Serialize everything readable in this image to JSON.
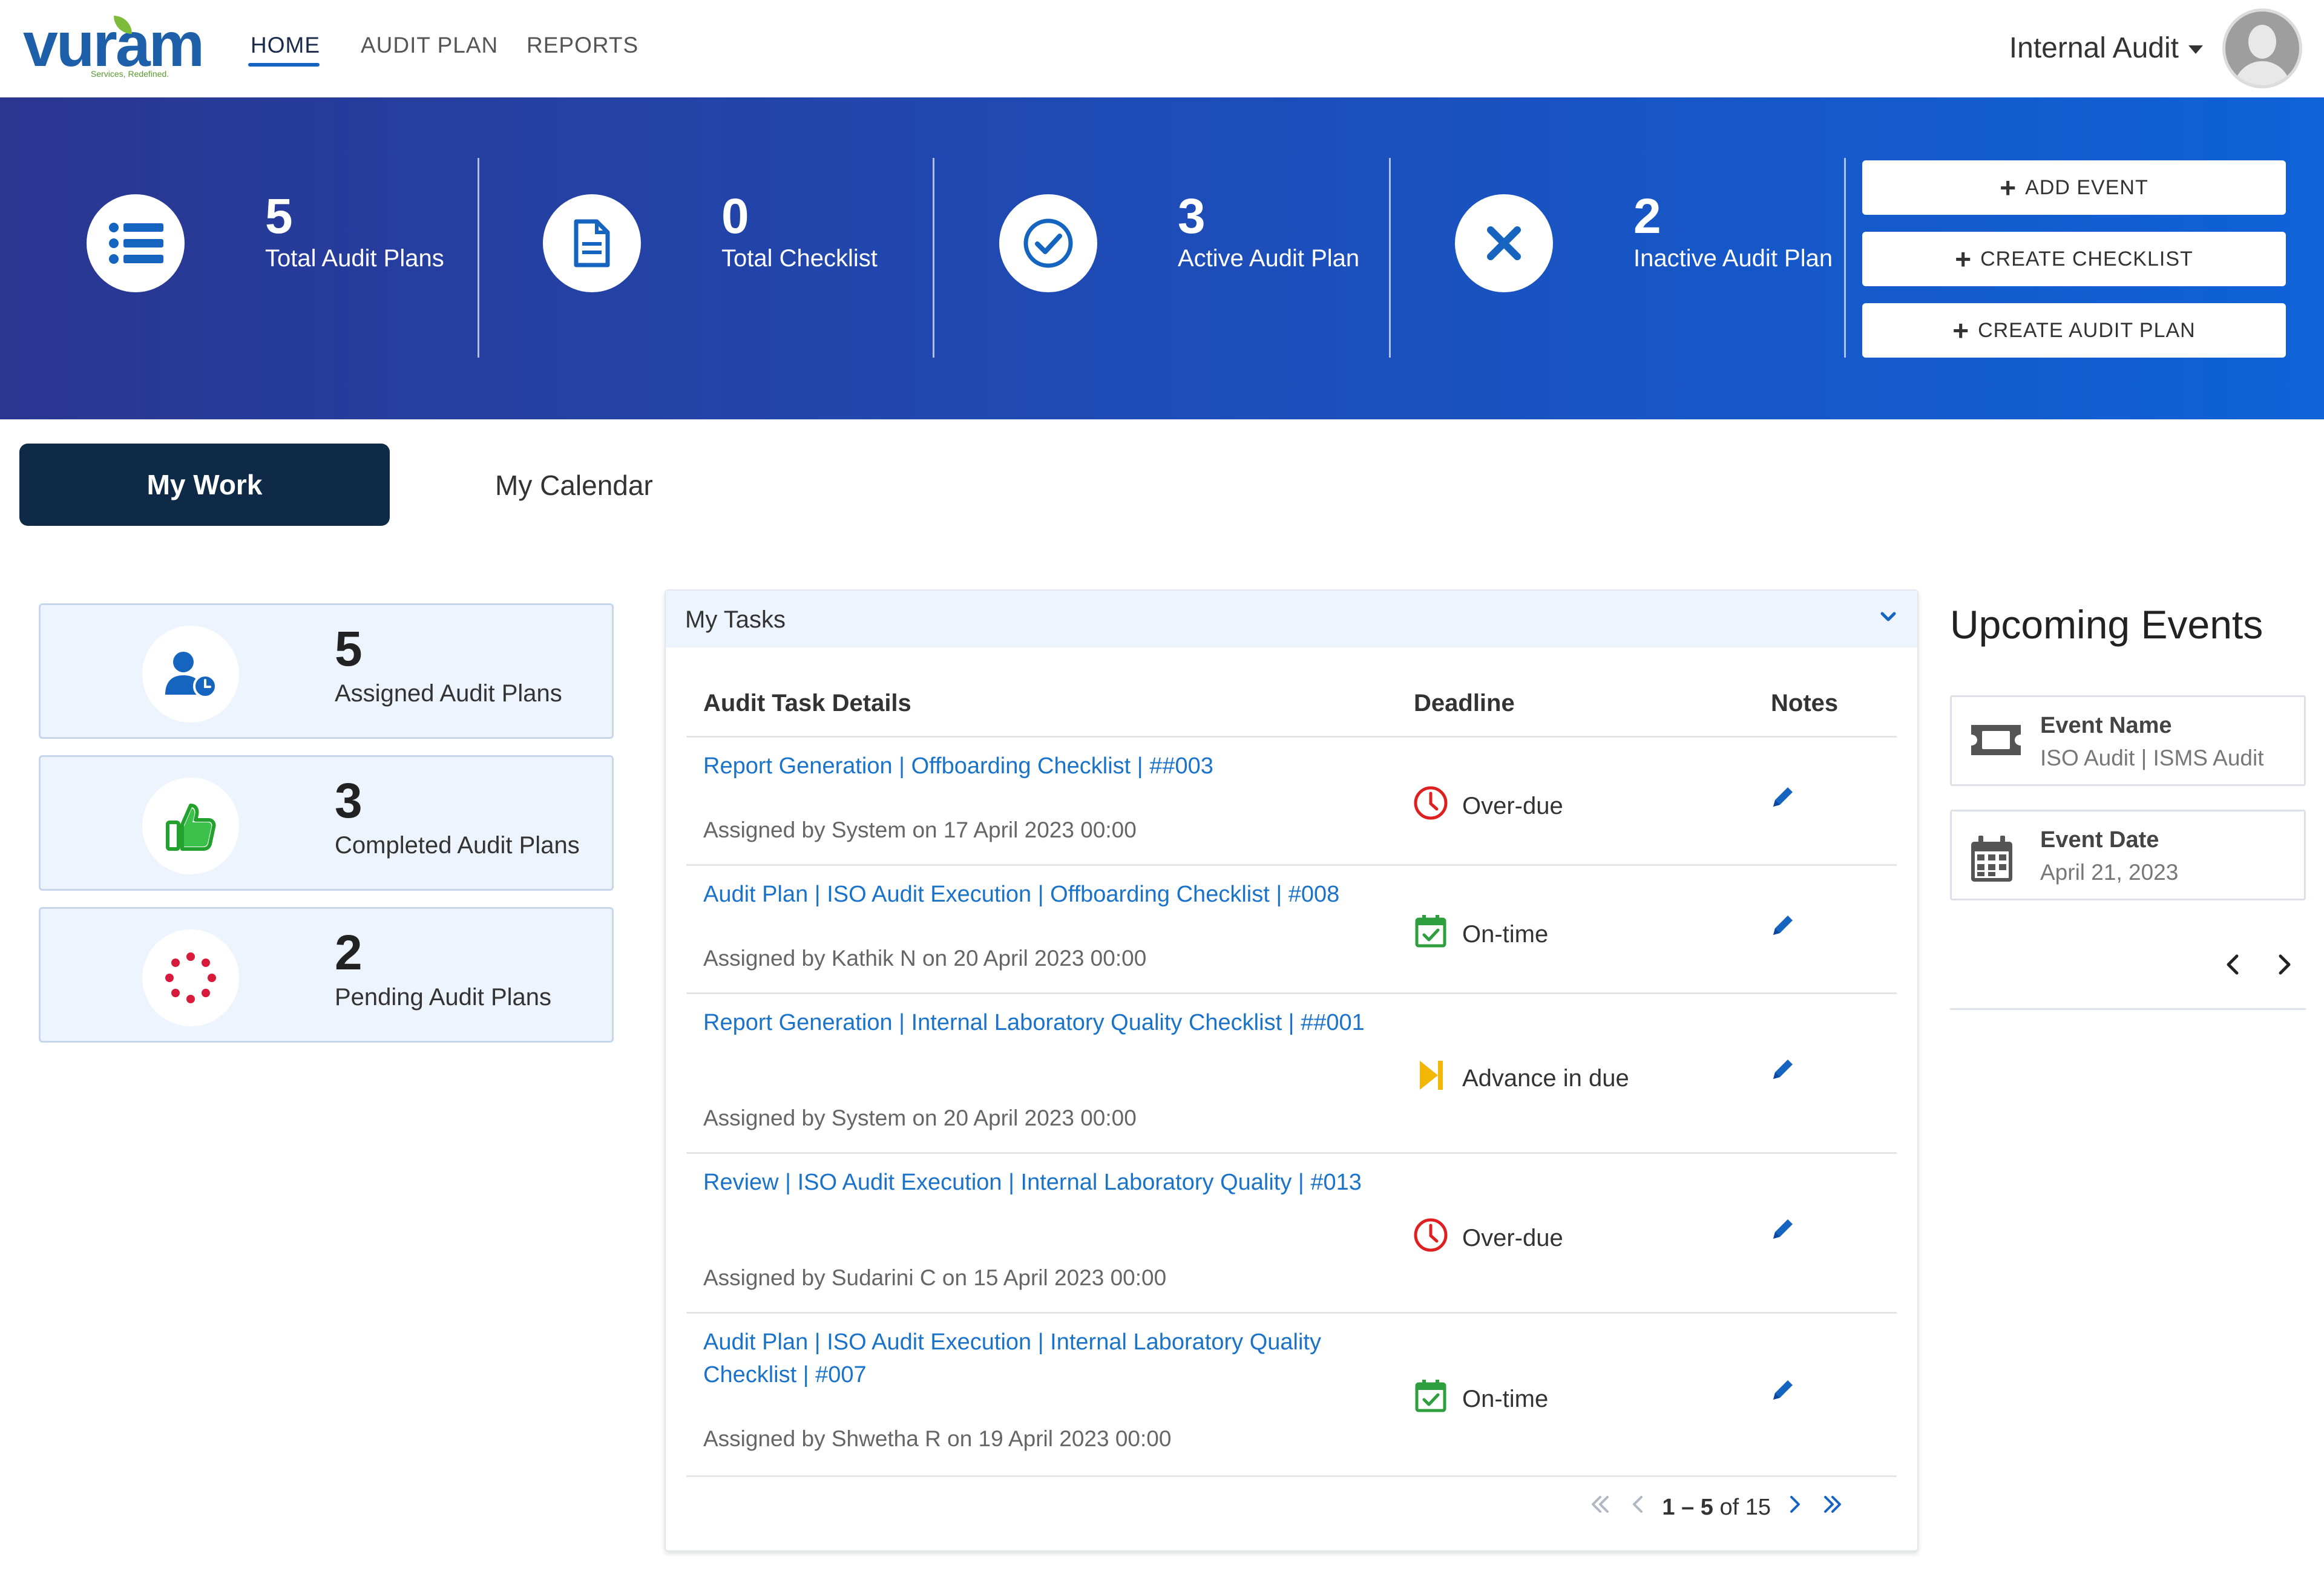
{
  "brand": {
    "logo_text": "vuram",
    "tagline": "Services, Redefined."
  },
  "nav": {
    "items": [
      {
        "label": "HOME"
      },
      {
        "label": "AUDIT PLAN"
      },
      {
        "label": "REPORTS"
      }
    ]
  },
  "user": {
    "menu_label": "Internal Audit"
  },
  "stats": [
    {
      "value": "5",
      "label": "Total Audit Plans",
      "icon": "list-icon"
    },
    {
      "value": "0",
      "label": "Total Checklist",
      "icon": "document-icon"
    },
    {
      "value": "3",
      "label": "Active Audit Plan",
      "icon": "check-circle-icon"
    },
    {
      "value": "2",
      "label": "Inactive Audit Plan",
      "icon": "x-icon"
    }
  ],
  "actions": {
    "add_event": "ADD EVENT",
    "create_checklist": "CREATE CHECKLIST",
    "create_audit_plan": "CREATE AUDIT PLAN"
  },
  "tabs": {
    "my_work": "My Work",
    "my_calendar": "My Calendar"
  },
  "summary": [
    {
      "value": "5",
      "label": "Assigned Audit Plans",
      "icon": "user-clock-icon"
    },
    {
      "value": "3",
      "label": "Completed Audit Plans",
      "icon": "thumbs-up-icon"
    },
    {
      "value": "2",
      "label": "Pending Audit Plans",
      "icon": "spinner-icon"
    }
  ],
  "tasks": {
    "title": "My Tasks",
    "columns": {
      "details": "Audit Task Details",
      "deadline": "Deadline",
      "notes": "Notes"
    },
    "rows": [
      {
        "title": "Report Generation | Offboarding Checklist | ##003",
        "assigned": "Assigned by System on 17 April 2023 00:00",
        "status": "Over-due",
        "status_icon": "clock-icon",
        "status_color": "#e02020"
      },
      {
        "title": "Audit Plan | ISO Audit Execution | Offboarding Checklist | #008",
        "assigned": "Assigned by Kathik N on 20 April 2023 00:00",
        "status": "On-time",
        "status_icon": "calendar-check-icon",
        "status_color": "#2e9e3e"
      },
      {
        "title": "Report Generation | Internal Laboratory Quality Checklist | ##001",
        "assigned": "Assigned by System on 20 April 2023 00:00",
        "status": "Advance in due",
        "status_icon": "skip-forward-icon",
        "status_color": "#f2b705"
      },
      {
        "title": "Review | ISO Audit Execution | Internal Laboratory Quality | #013",
        "assigned": "Assigned by  Sudarini C on 15 April 2023 00:00",
        "status": "Over-due",
        "status_icon": "clock-icon",
        "status_color": "#e02020"
      },
      {
        "title": "Audit Plan | ISO Audit Execution | Internal Laboratory Quality Checklist | #007",
        "assigned": "Assigned by Shwetha R on 19 April 2023 00:00",
        "status": "On-time",
        "status_icon": "calendar-check-icon",
        "status_color": "#2e9e3e"
      }
    ],
    "pagination": {
      "range": "1 – 5",
      "of_label": "of 15"
    }
  },
  "events": {
    "title": "Upcoming Events",
    "name_label": "Event Name",
    "name_value": "ISO Audit  |  ISMS Audit",
    "date_label": "Event Date",
    "date_value": "April 21, 2023"
  },
  "colors": {
    "banner_start": "#2a3690",
    "banner_end": "#0f62d8",
    "accent": "#1565c0",
    "link": "#1a73c9",
    "tab_active": "#0e2a47"
  }
}
